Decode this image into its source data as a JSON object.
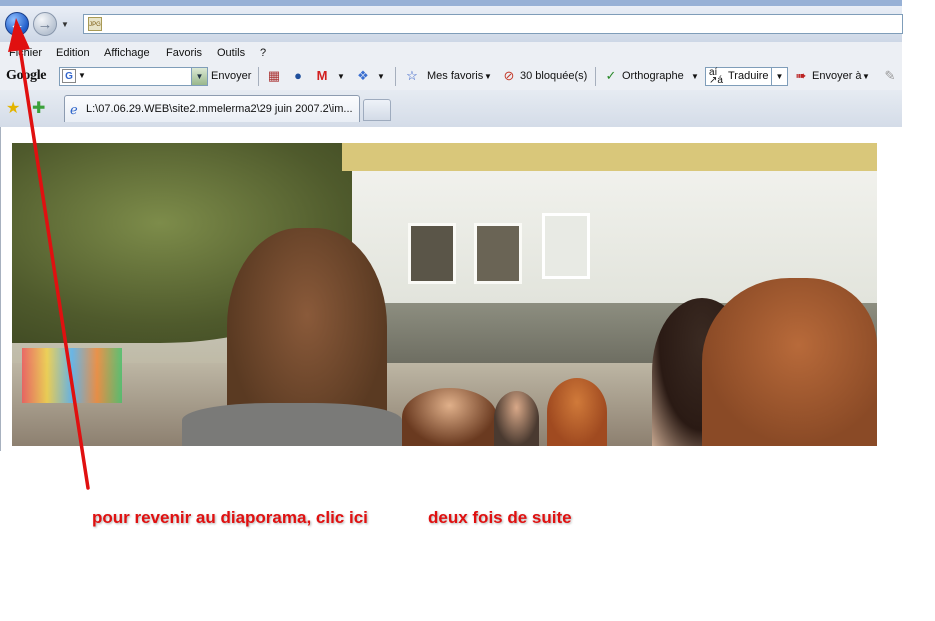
{
  "menu": {
    "items": [
      "Fichier",
      "Edition",
      "Affichage",
      "Favoris",
      "Outils",
      "?"
    ]
  },
  "google_toolbar": {
    "logo": "Google",
    "send_label": "Envoyer",
    "favorites_label": "Mes favoris",
    "popups_blocked": "30 bloquée(s)",
    "spellcheck_label": "Orthographe",
    "translate_label": "Traduire",
    "send_to_label": "Envoyer à"
  },
  "tabs": [
    {
      "title": "L:\\07.06.29.WEB\\site2.mmelerma2\\29 juin 2007.2\\im..."
    }
  ],
  "annotations": {
    "instruction_left": "pour revenir au diaporama, clic ici",
    "instruction_right": "deux fois de suite",
    "color": "#e01010"
  }
}
